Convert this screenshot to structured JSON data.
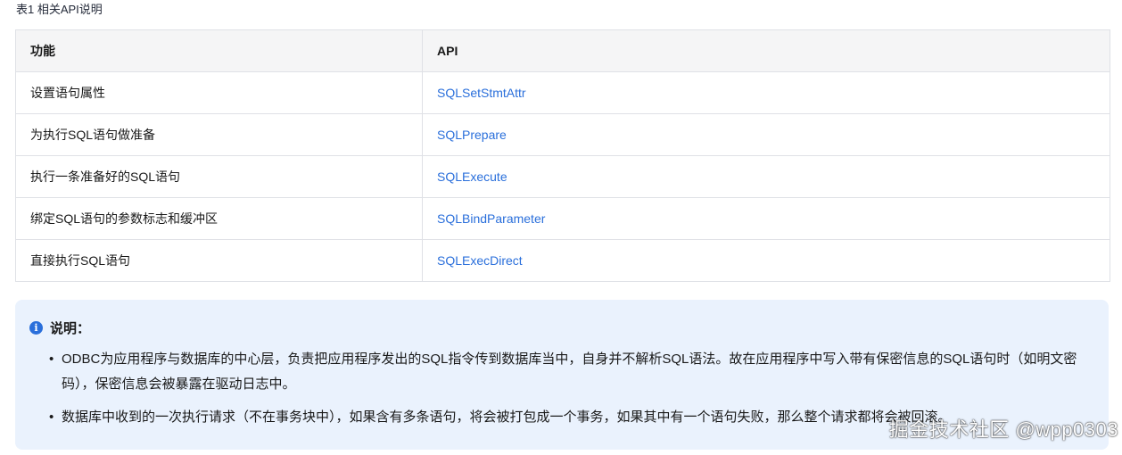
{
  "caption": "表1 相关API说明",
  "table": {
    "headers": [
      "功能",
      "API"
    ],
    "rows": [
      {
        "function": "设置语句属性",
        "api": "SQLSetStmtAttr"
      },
      {
        "function": "为执行SQL语句做准备",
        "api": "SQLPrepare"
      },
      {
        "function": "执行一条准备好的SQL语句",
        "api": "SQLExecute"
      },
      {
        "function": "绑定SQL语句的参数标志和缓冲区",
        "api": "SQLBindParameter"
      },
      {
        "function": "直接执行SQL语句",
        "api": "SQLExecDirect"
      }
    ]
  },
  "note": {
    "icon": "info-icon",
    "title": "说明：",
    "items": [
      "ODBC为应用程序与数据库的中心层，负责把应用程序发出的SQL指令传到数据库当中，自身并不解析SQL语法。故在应用程序中写入带有保密信息的SQL语句时（如明文密码），保密信息会被暴露在驱动日志中。",
      "数据库中收到的一次执行请求（不在事务块中），如果含有多条语句，将会被打包成一个事务，如果其中有一个语句失败，那么整个请求都将会被回滚。"
    ]
  },
  "watermark": "掘金技术社区 @wpp0303",
  "colors": {
    "link": "#2a6fdb",
    "note_background": "#eaf2fd",
    "header_background": "#f5f5f6",
    "border": "#dfe1e6"
  }
}
